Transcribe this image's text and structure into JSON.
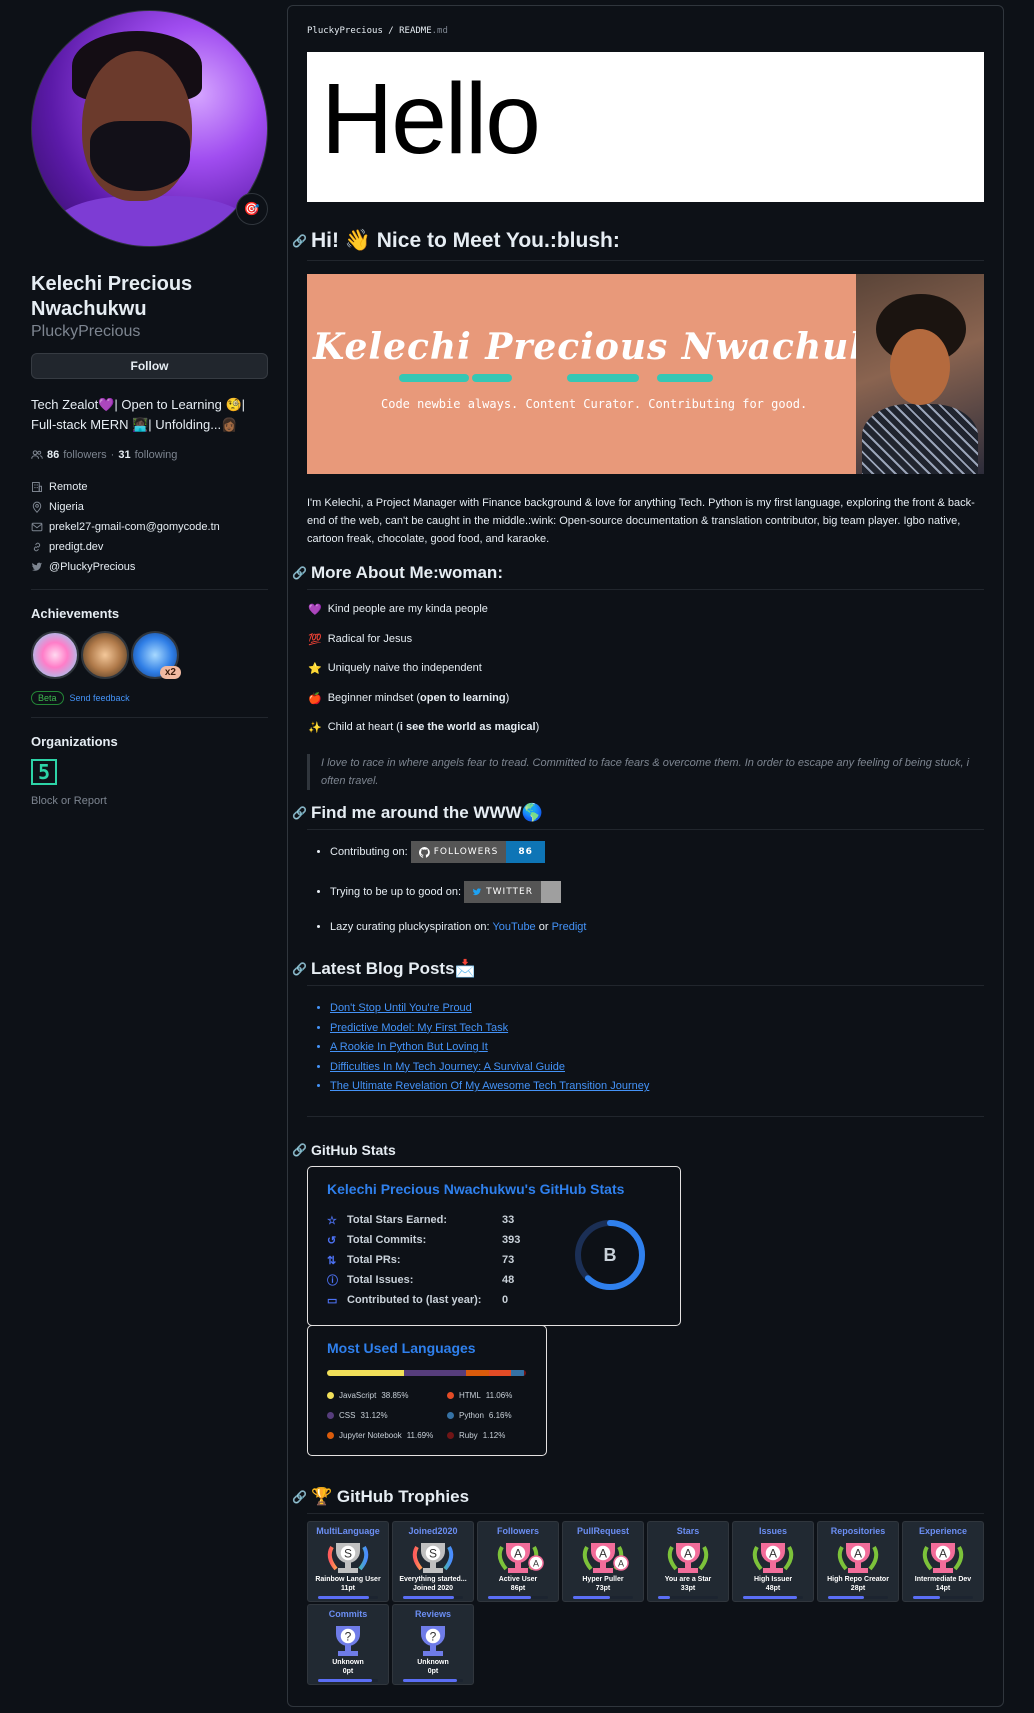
{
  "profile": {
    "full_name": "Kelechi Precious Nwachukwu",
    "login": "PluckyPrecious",
    "follow_label": "Follow",
    "bio": "Tech Zealot💜| Open to Learning 🧐| Full-stack MERN 👩🏿‍💻| Unfolding...👩🏾",
    "followers_count": "86",
    "followers_label": "followers",
    "sep": "·",
    "following_count": "31",
    "following_label": "following",
    "status_emoji": "🎯",
    "details": [
      {
        "icon": "building-icon",
        "text": "Remote"
      },
      {
        "icon": "location-icon",
        "text": "Nigeria"
      },
      {
        "icon": "mail-icon",
        "text": "prekel27-gmail-com@gomycode.tn"
      },
      {
        "icon": "link-icon",
        "text": "predigt.dev"
      },
      {
        "icon": "twitter-icon",
        "text": "@PluckyPrecious"
      }
    ],
    "achievements_heading": "Achievements",
    "achievement_extra_count": "x2",
    "beta_label": "Beta",
    "feedback_label": "Send feedback",
    "organizations_heading": "Organizations",
    "org_logo_text": "5",
    "block_label": "Block or Report"
  },
  "readme": {
    "path_user": "PluckyPrecious",
    "path_sep": "/",
    "path_file": "README",
    "path_ext": ".md",
    "hello": "Hello",
    "h_hi": "Hi! 👋 Nice to Meet You.:blush:",
    "banner_name": "Kelechi Precious Nwachukwu",
    "banner_tagline": "Code newbie always. Content Curator. Contributing for good.",
    "intro": "I'm Kelechi, a Project Manager with Finance background & love for anything Tech. Python is my first language, exploring the front & back-end of the web, can't be caught in the middle.:wink: Open-source documentation & translation contributor, big team player. Igbo native, cartoon freak, chocolate, good food, and karaoke.",
    "h_more": "More About Me:woman:",
    "more_items": [
      {
        "emoji": "💜",
        "pre": "Kind people are my kinda people",
        "bold": "",
        "post": ""
      },
      {
        "emoji": "💯",
        "pre": "Radical for Jesus",
        "bold": "",
        "post": ""
      },
      {
        "emoji": "⭐",
        "pre": "Uniquely naive tho independent",
        "bold": "",
        "post": ""
      },
      {
        "emoji": "🍎",
        "pre": "Beginner mindset (",
        "bold": "open to learning",
        "post": ")"
      },
      {
        "emoji": "✨",
        "pre": "Child at heart (",
        "bold": "i see the world as magical",
        "post": ")"
      }
    ],
    "quote": "I love to race in where angels fear to tread. Committed to face fears & overcome them. In order to escape any feeling of being stuck, i often travel.",
    "h_find": "Find me around the WWW🌎",
    "find_contrib": "Contributing on:",
    "followers_badge_label": "FOLLOWERS",
    "followers_badge_value": "86",
    "find_twitter": "Trying to be up to good on:",
    "twitter_badge_label": "TWITTER",
    "find_lazy": "Lazy curating pluckyspiration on: ",
    "youtube_link": "YouTube",
    "or_text": " or ",
    "predigt_link": "Predigt",
    "h_blog": "Latest Blog Posts📩",
    "blog_posts": [
      "Don't Stop Until You're Proud",
      "Predictive Model: My First Tech Task",
      "A Rookie In Python But Loving It",
      "Difficulties In My Tech Journey: A Survival Guide",
      "The Ultimate Revelation Of My Awesome Tech Transition Journey"
    ],
    "h_stats": "GitHub Stats",
    "h_trophies": "🏆 GitHub Trophies"
  },
  "stats_card": {
    "title": "Kelechi Precious Nwachukwu's GitHub Stats",
    "rank": "B",
    "rank_progress": 0.62,
    "rows": [
      {
        "icon": "star-icon",
        "label": "Total Stars Earned:",
        "value": "33"
      },
      {
        "icon": "history-icon",
        "label": "Total Commits:",
        "value": "393"
      },
      {
        "icon": "pull-request-icon",
        "label": "Total PRs:",
        "value": "73"
      },
      {
        "icon": "issue-icon",
        "label": "Total Issues:",
        "value": "48"
      },
      {
        "icon": "repo-icon",
        "label": "Contributed to (last year):",
        "value": "0"
      }
    ]
  },
  "lang_card": {
    "title": "Most Used Languages",
    "languages": [
      {
        "name": "JavaScript",
        "pct": "38.85%",
        "value": 38.85,
        "color": "#f1e05a"
      },
      {
        "name": "CSS",
        "pct": "31.12%",
        "value": 31.12,
        "color": "#563d7c"
      },
      {
        "name": "Jupyter Notebook",
        "pct": "11.69%",
        "value": 11.69,
        "color": "#da5b0b"
      },
      {
        "name": "HTML",
        "pct": "11.06%",
        "value": 11.06,
        "color": "#e34c26"
      },
      {
        "name": "Python",
        "pct": "6.16%",
        "value": 6.16,
        "color": "#3572a5"
      },
      {
        "name": "Ruby",
        "pct": "1.12%",
        "value": 1.12,
        "color": "#701516"
      }
    ]
  },
  "trophies": [
    {
      "title": "MultiLanguage",
      "rank": "S",
      "name": "Rainbow Lang User",
      "points": "11pt",
      "progress": 0.85,
      "style": "rainbow"
    },
    {
      "title": "Joined2020",
      "rank": "S",
      "name": "Everything started...",
      "name2": "Joined 2020",
      "points": "",
      "progress": 0.85,
      "style": "rainbow"
    },
    {
      "title": "Followers",
      "rank": "A",
      "name": "Active User",
      "points": "86pt",
      "progress": 0.72,
      "style": "pink",
      "sub": "A"
    },
    {
      "title": "PullRequest",
      "rank": "A",
      "name": "Hyper Puller",
      "points": "73pt",
      "progress": 0.62,
      "style": "pink",
      "sub": "A"
    },
    {
      "title": "Stars",
      "rank": "A",
      "name": "You are a Star",
      "points": "33pt",
      "progress": 0.2,
      "style": "pink"
    },
    {
      "title": "Issues",
      "rank": "A",
      "name": "High Issuer",
      "points": "48pt",
      "progress": 0.9,
      "style": "pink"
    },
    {
      "title": "Repositories",
      "rank": "A",
      "name": "High Repo Creator",
      "points": "28pt",
      "progress": 0.6,
      "style": "pink"
    },
    {
      "title": "Experience",
      "rank": "A",
      "name": "Intermediate Dev",
      "points": "14pt",
      "progress": 0.45,
      "style": "pink"
    },
    {
      "title": "Commits",
      "rank": "?",
      "name": "Unknown",
      "points": "0pt",
      "progress": 0.9,
      "style": "unknown"
    },
    {
      "title": "Reviews",
      "rank": "?",
      "name": "Unknown",
      "points": "0pt",
      "progress": 0.9,
      "style": "unknown"
    }
  ]
}
